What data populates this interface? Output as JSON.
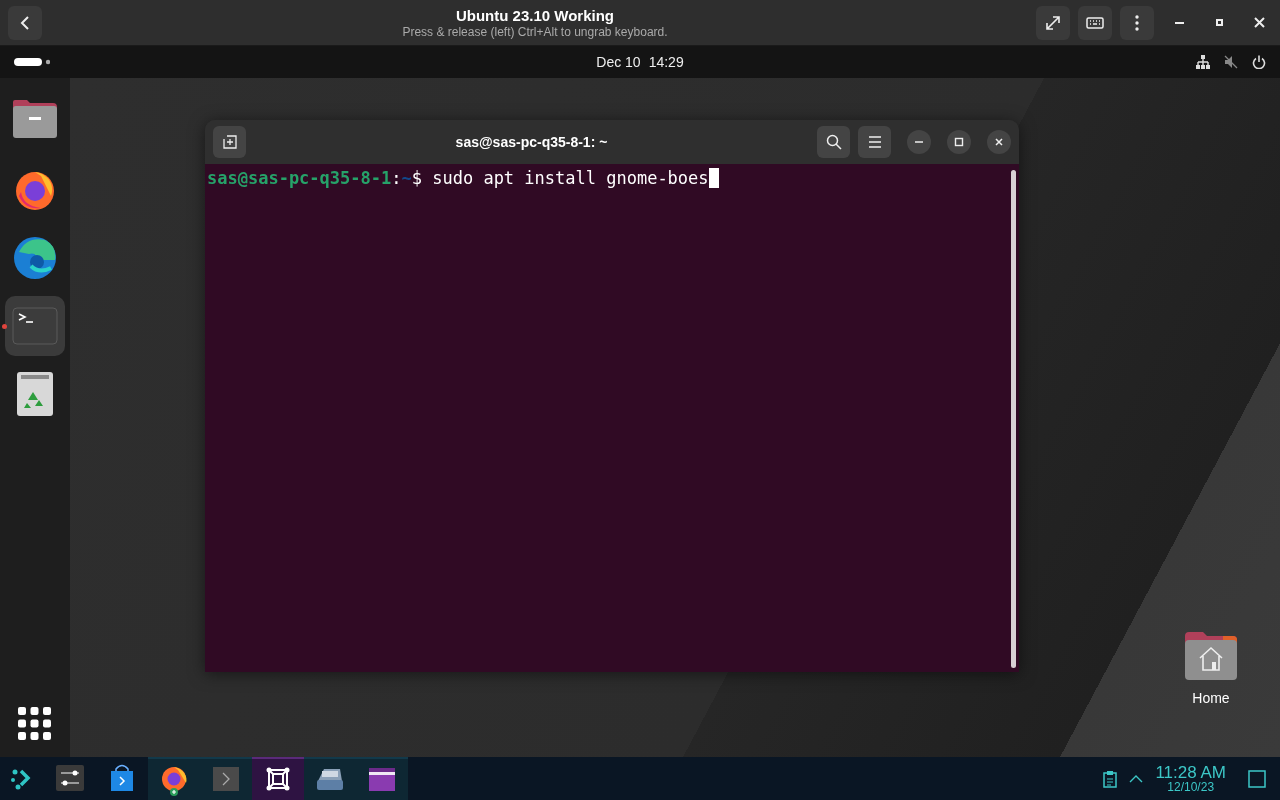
{
  "viewer": {
    "title": "Ubuntu 23.10 Working",
    "subtitle": "Press & release (left) Ctrl+Alt to ungrab keyboard."
  },
  "top_panel": {
    "date": "Dec 10",
    "time": "14:29"
  },
  "dock": {
    "items": [
      {
        "kind": "files",
        "running": false
      },
      {
        "kind": "firefox",
        "running": false
      },
      {
        "kind": "edge",
        "running": false
      },
      {
        "kind": "terminal",
        "running": true
      },
      {
        "kind": "trash",
        "running": false
      }
    ]
  },
  "terminal": {
    "title": "sas@sas-pc-q35-8-1: ~",
    "prompt": "sas@sas-pc-q35-8-1",
    "separator": ":",
    "path": "~",
    "symbol": "$",
    "command": "sudo apt install gnome-boes"
  },
  "desktop_icons": [
    {
      "label": "Home"
    }
  ],
  "taskbar": {
    "items": [
      {
        "kind": "launcher",
        "running": false,
        "selected": false
      },
      {
        "kind": "settings",
        "running": false,
        "selected": false
      },
      {
        "kind": "store",
        "running": false,
        "selected": false
      },
      {
        "kind": "firefox",
        "running": true,
        "selected": false
      },
      {
        "kind": "terminal",
        "running": true,
        "selected": false
      },
      {
        "kind": "boxes",
        "running": true,
        "selected": true
      },
      {
        "kind": "scanner",
        "running": true,
        "selected": false
      },
      {
        "kind": "files",
        "running": true,
        "selected": false
      }
    ],
    "time": "11:28 AM",
    "date": "12/10/23"
  }
}
